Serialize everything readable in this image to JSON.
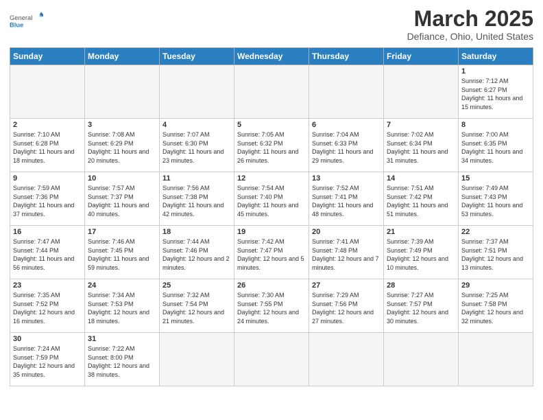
{
  "header": {
    "logo_general": "General",
    "logo_blue": "Blue",
    "month_title": "March 2025",
    "location": "Defiance, Ohio, United States"
  },
  "days_of_week": [
    "Sunday",
    "Monday",
    "Tuesday",
    "Wednesday",
    "Thursday",
    "Friday",
    "Saturday"
  ],
  "weeks": [
    [
      {
        "num": "",
        "empty": true
      },
      {
        "num": "",
        "empty": true
      },
      {
        "num": "",
        "empty": true
      },
      {
        "num": "",
        "empty": true
      },
      {
        "num": "",
        "empty": true
      },
      {
        "num": "",
        "empty": true
      },
      {
        "num": "1",
        "sunrise": "7:12 AM",
        "sunset": "6:27 PM",
        "daylight": "11 hours and 15 minutes."
      }
    ],
    [
      {
        "num": "2",
        "sunrise": "7:10 AM",
        "sunset": "6:28 PM",
        "daylight": "11 hours and 18 minutes."
      },
      {
        "num": "3",
        "sunrise": "7:08 AM",
        "sunset": "6:29 PM",
        "daylight": "11 hours and 20 minutes."
      },
      {
        "num": "4",
        "sunrise": "7:07 AM",
        "sunset": "6:30 PM",
        "daylight": "11 hours and 23 minutes."
      },
      {
        "num": "5",
        "sunrise": "7:05 AM",
        "sunset": "6:32 PM",
        "daylight": "11 hours and 26 minutes."
      },
      {
        "num": "6",
        "sunrise": "7:04 AM",
        "sunset": "6:33 PM",
        "daylight": "11 hours and 29 minutes."
      },
      {
        "num": "7",
        "sunrise": "7:02 AM",
        "sunset": "6:34 PM",
        "daylight": "11 hours and 31 minutes."
      },
      {
        "num": "8",
        "sunrise": "7:00 AM",
        "sunset": "6:35 PM",
        "daylight": "11 hours and 34 minutes."
      }
    ],
    [
      {
        "num": "9",
        "sunrise": "7:59 AM",
        "sunset": "7:36 PM",
        "daylight": "11 hours and 37 minutes."
      },
      {
        "num": "10",
        "sunrise": "7:57 AM",
        "sunset": "7:37 PM",
        "daylight": "11 hours and 40 minutes."
      },
      {
        "num": "11",
        "sunrise": "7:56 AM",
        "sunset": "7:38 PM",
        "daylight": "11 hours and 42 minutes."
      },
      {
        "num": "12",
        "sunrise": "7:54 AM",
        "sunset": "7:40 PM",
        "daylight": "11 hours and 45 minutes."
      },
      {
        "num": "13",
        "sunrise": "7:52 AM",
        "sunset": "7:41 PM",
        "daylight": "11 hours and 48 minutes."
      },
      {
        "num": "14",
        "sunrise": "7:51 AM",
        "sunset": "7:42 PM",
        "daylight": "11 hours and 51 minutes."
      },
      {
        "num": "15",
        "sunrise": "7:49 AM",
        "sunset": "7:43 PM",
        "daylight": "11 hours and 53 minutes."
      }
    ],
    [
      {
        "num": "16",
        "sunrise": "7:47 AM",
        "sunset": "7:44 PM",
        "daylight": "11 hours and 56 minutes."
      },
      {
        "num": "17",
        "sunrise": "7:46 AM",
        "sunset": "7:45 PM",
        "daylight": "11 hours and 59 minutes."
      },
      {
        "num": "18",
        "sunrise": "7:44 AM",
        "sunset": "7:46 PM",
        "daylight": "12 hours and 2 minutes."
      },
      {
        "num": "19",
        "sunrise": "7:42 AM",
        "sunset": "7:47 PM",
        "daylight": "12 hours and 5 minutes."
      },
      {
        "num": "20",
        "sunrise": "7:41 AM",
        "sunset": "7:48 PM",
        "daylight": "12 hours and 7 minutes."
      },
      {
        "num": "21",
        "sunrise": "7:39 AM",
        "sunset": "7:49 PM",
        "daylight": "12 hours and 10 minutes."
      },
      {
        "num": "22",
        "sunrise": "7:37 AM",
        "sunset": "7:51 PM",
        "daylight": "12 hours and 13 minutes."
      }
    ],
    [
      {
        "num": "23",
        "sunrise": "7:35 AM",
        "sunset": "7:52 PM",
        "daylight": "12 hours and 16 minutes."
      },
      {
        "num": "24",
        "sunrise": "7:34 AM",
        "sunset": "7:53 PM",
        "daylight": "12 hours and 18 minutes."
      },
      {
        "num": "25",
        "sunrise": "7:32 AM",
        "sunset": "7:54 PM",
        "daylight": "12 hours and 21 minutes."
      },
      {
        "num": "26",
        "sunrise": "7:30 AM",
        "sunset": "7:55 PM",
        "daylight": "12 hours and 24 minutes."
      },
      {
        "num": "27",
        "sunrise": "7:29 AM",
        "sunset": "7:56 PM",
        "daylight": "12 hours and 27 minutes."
      },
      {
        "num": "28",
        "sunrise": "7:27 AM",
        "sunset": "7:57 PM",
        "daylight": "12 hours and 30 minutes."
      },
      {
        "num": "29",
        "sunrise": "7:25 AM",
        "sunset": "7:58 PM",
        "daylight": "12 hours and 32 minutes."
      }
    ],
    [
      {
        "num": "30",
        "sunrise": "7:24 AM",
        "sunset": "7:59 PM",
        "daylight": "12 hours and 35 minutes."
      },
      {
        "num": "31",
        "sunrise": "7:22 AM",
        "sunset": "8:00 PM",
        "daylight": "12 hours and 38 minutes."
      },
      {
        "num": "",
        "empty": true
      },
      {
        "num": "",
        "empty": true
      },
      {
        "num": "",
        "empty": true
      },
      {
        "num": "",
        "empty": true
      },
      {
        "num": "",
        "empty": true
      }
    ]
  ]
}
